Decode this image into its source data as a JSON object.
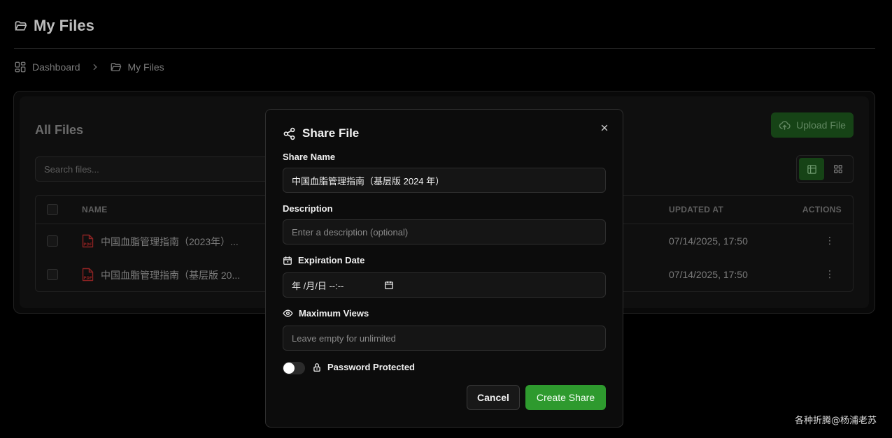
{
  "page": {
    "title": "My Files",
    "breadcrumb": [
      "Dashboard",
      "My Files"
    ]
  },
  "files_card": {
    "title": "All Files",
    "upload_label": "Upload File",
    "search_placeholder": "Search files...",
    "table": {
      "columns": {
        "name": "NAME",
        "updated": "UPDATED AT",
        "actions": "ACTIONS"
      },
      "rows": [
        {
          "name": "中国血脂管理指南（2023年）...",
          "updated": "07/14/2025, 17:50",
          "actions": "⋮"
        },
        {
          "name": "中国血脂管理指南（基层版 20...",
          "updated": "07/14/2025, 17:50",
          "actions": "⋮"
        }
      ]
    }
  },
  "modal": {
    "title": "Share File",
    "share_name_label": "Share Name",
    "share_name_value": "中国血脂管理指南（基层版 2024 年）",
    "description_label": "Description",
    "description_placeholder": "Enter a description (optional)",
    "expiration_label": "Expiration Date",
    "expiration_value": "年 /月/日 --:--",
    "max_views_label": "Maximum Views",
    "max_views_placeholder": "Leave empty for unlimited",
    "password_label": "Password Protected",
    "password_enabled": false,
    "cancel_label": "Cancel",
    "create_label": "Create Share"
  },
  "watermark": "各种折腾@杨浦老苏",
  "colors": {
    "accent": "#2e9a2e",
    "accent_dim": "#1a4d1a",
    "background": "#000000",
    "modal_bg": "#0c0c0c",
    "pdf_red": "#a02828"
  },
  "icons": {
    "header": "folder-open-icon",
    "breadcrumb_home": "dashboard-grid-icon",
    "breadcrumb_sep": "chevron-right-icon",
    "upload": "cloud-upload-icon",
    "view_table": "table-view-icon",
    "view_grid": "grid-view-icon",
    "file": "pdf-file-icon",
    "row_actions": "more-vertical-icon",
    "share": "share-icon",
    "close": "close-icon",
    "calendar": "calendar-icon",
    "eye": "eye-icon",
    "lock": "lock-icon"
  }
}
